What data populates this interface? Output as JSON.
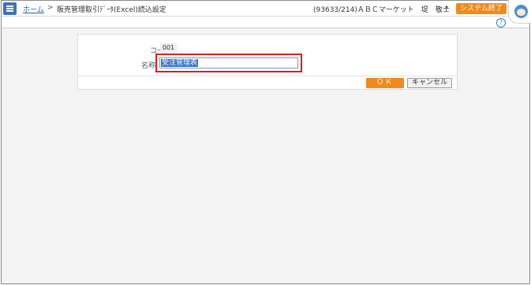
{
  "header": {
    "home_link": "ホーム",
    "separator": ">",
    "page_title": "販売管理取引ﾃﾞｰﾀ(Excel)読込設定",
    "user_info": "(93633/214)ＡＢＣマーケット　堤　敬士",
    "user_dropdown": "▾",
    "exit_button": "システム終了"
  },
  "help_icon": "?",
  "form": {
    "code_label": "コード",
    "code_value": "001",
    "name_label": "名称",
    "name_value": "受注管理表"
  },
  "buttons": {
    "ok": "ＯＫ",
    "cancel": "キャンセル"
  },
  "icons": {
    "menu": "hamburger-icon",
    "help": "question-circle-icon",
    "avatar": "assistant-avatar-icon"
  },
  "colors": {
    "accent_blue": "#3b73b9",
    "orange": "#f08a1c",
    "highlight_red": "#e31a1a"
  }
}
